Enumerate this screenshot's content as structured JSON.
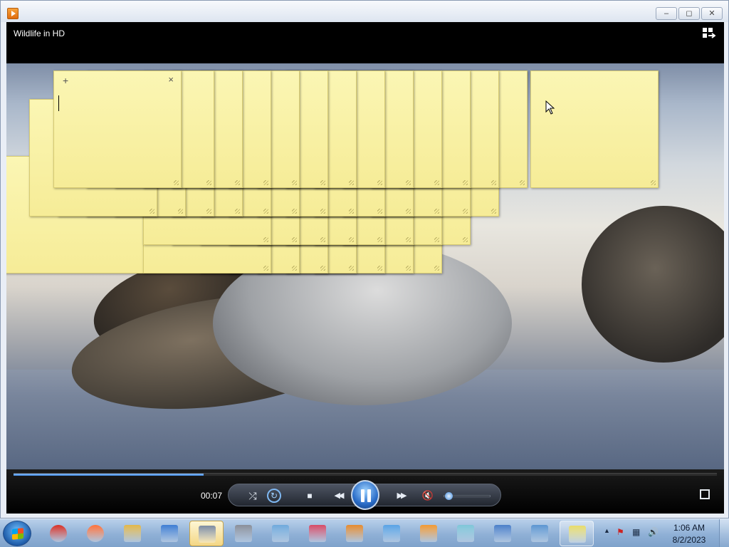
{
  "window": {
    "controls": {
      "minimize": "–",
      "restore": "◻",
      "close": "✕"
    }
  },
  "player": {
    "title": "Wildlife in HD",
    "time": "00:07",
    "progress_fraction": 0.27,
    "volume_fraction": 0.05,
    "muted": true,
    "icons": {
      "shuffle": "⤮",
      "repeat": "↻",
      "stop": "■",
      "previous": "◀◀",
      "next": "▶▶",
      "mute": "🔇"
    }
  },
  "sticky_notes": {
    "add_symbol": "+",
    "close_symbol": "×"
  },
  "taskbar": {
    "apps": [
      {
        "name": "chrome",
        "color": "#d93025"
      },
      {
        "name": "firefox",
        "color": "#ff7139"
      },
      {
        "name": "file-explorer",
        "color": "#e2b74a"
      },
      {
        "name": "remote-desktop",
        "color": "#3d7dd3"
      },
      {
        "name": "calculator",
        "color": "#7d8ca3"
      },
      {
        "name": "fax-scan",
        "color": "#8a8f99"
      },
      {
        "name": "notepad-doc",
        "color": "#6fa9dc"
      },
      {
        "name": "snipping-tool",
        "color": "#d74b66"
      },
      {
        "name": "paint",
        "color": "#e58b2f"
      },
      {
        "name": "mail",
        "color": "#58a3e6"
      },
      {
        "name": "media-player",
        "color": "#f29a34"
      },
      {
        "name": "notepad",
        "color": "#7fc6d8"
      },
      {
        "name": "wordpad",
        "color": "#4a7fc9"
      },
      {
        "name": "control-panel",
        "color": "#5c96d1"
      },
      {
        "name": "sticky-notes",
        "color": "#e8dc6a"
      }
    ],
    "clock_time": "1:06 AM",
    "clock_date": "8/2/2023",
    "tray": {
      "expand": "▲",
      "flag": "⚑",
      "network": "▦",
      "volume": "🔊"
    }
  }
}
